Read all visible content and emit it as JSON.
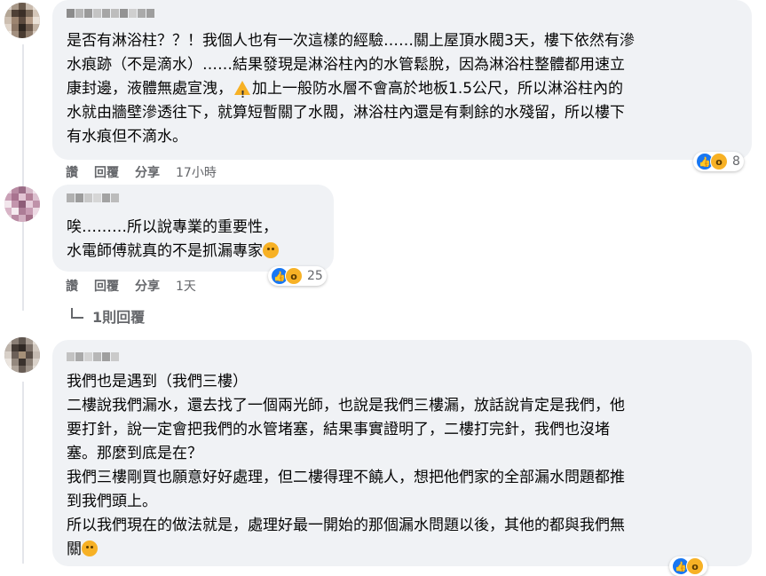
{
  "comments": [
    {
      "lines": [
        "是否有淋浴柱？？！我個人也有一次這樣的經驗……關上屋頂水閥3天，樓下依然有滲",
        "水痕跡（不是滴水）……結果發現是淋浴柱內的水管鬆脫，因為淋浴柱整體都用速立",
        "康封邊，液體無處宣洩，",
        "加上一般防水層不會高於地板1.5公尺，所以淋浴柱內的",
        "水就由牆壁滲透往下，就算短暫關了水閥，淋浴柱內還是有剩餘的水殘留，所以樓下",
        "有水痕但不滴水。"
      ],
      "actions": {
        "like": "讚",
        "reply": "回覆",
        "share": "分享",
        "time": "17小時"
      },
      "reaction_count": "8"
    },
    {
      "lines": [
        "唉………所以說專業的重要性，",
        "水電師傅就真的不是抓漏專家"
      ],
      "actions": {
        "like": "讚",
        "reply": "回覆",
        "share": "分享",
        "time": "1天"
      },
      "reaction_count": "25"
    },
    {
      "lines": [
        "我們也是遇到（我們三樓）",
        "二樓說我們漏水，還去找了一個兩光師，也說是我們三樓漏，放話說肯定是我們，他",
        "要打針，說一定會把我們的水管堵塞，結果事實證明了，二樓打完針，我們也沒堵",
        "塞。那麼到底是在？",
        "我們三樓剛買也願意好好處理，但二樓得理不饒人，想把他們家的全部漏水問題都推",
        "到我們頭上。",
        "所以我們現在的做法就是，處理好最一開始的那個漏水問題以後，其他的都與我們無",
        "關"
      ]
    }
  ],
  "replies_link": "1則回覆",
  "icons": {
    "like": "like-icon",
    "wow": "wow-icon",
    "sad": "sad-emoji-icon",
    "warning": "warning-icon",
    "smile": "smile-emoji-icon"
  },
  "colors": {
    "bubble": "#f0f2f5",
    "meta": "#65676b",
    "like": "#1877f2",
    "wow": "#f7b125"
  }
}
